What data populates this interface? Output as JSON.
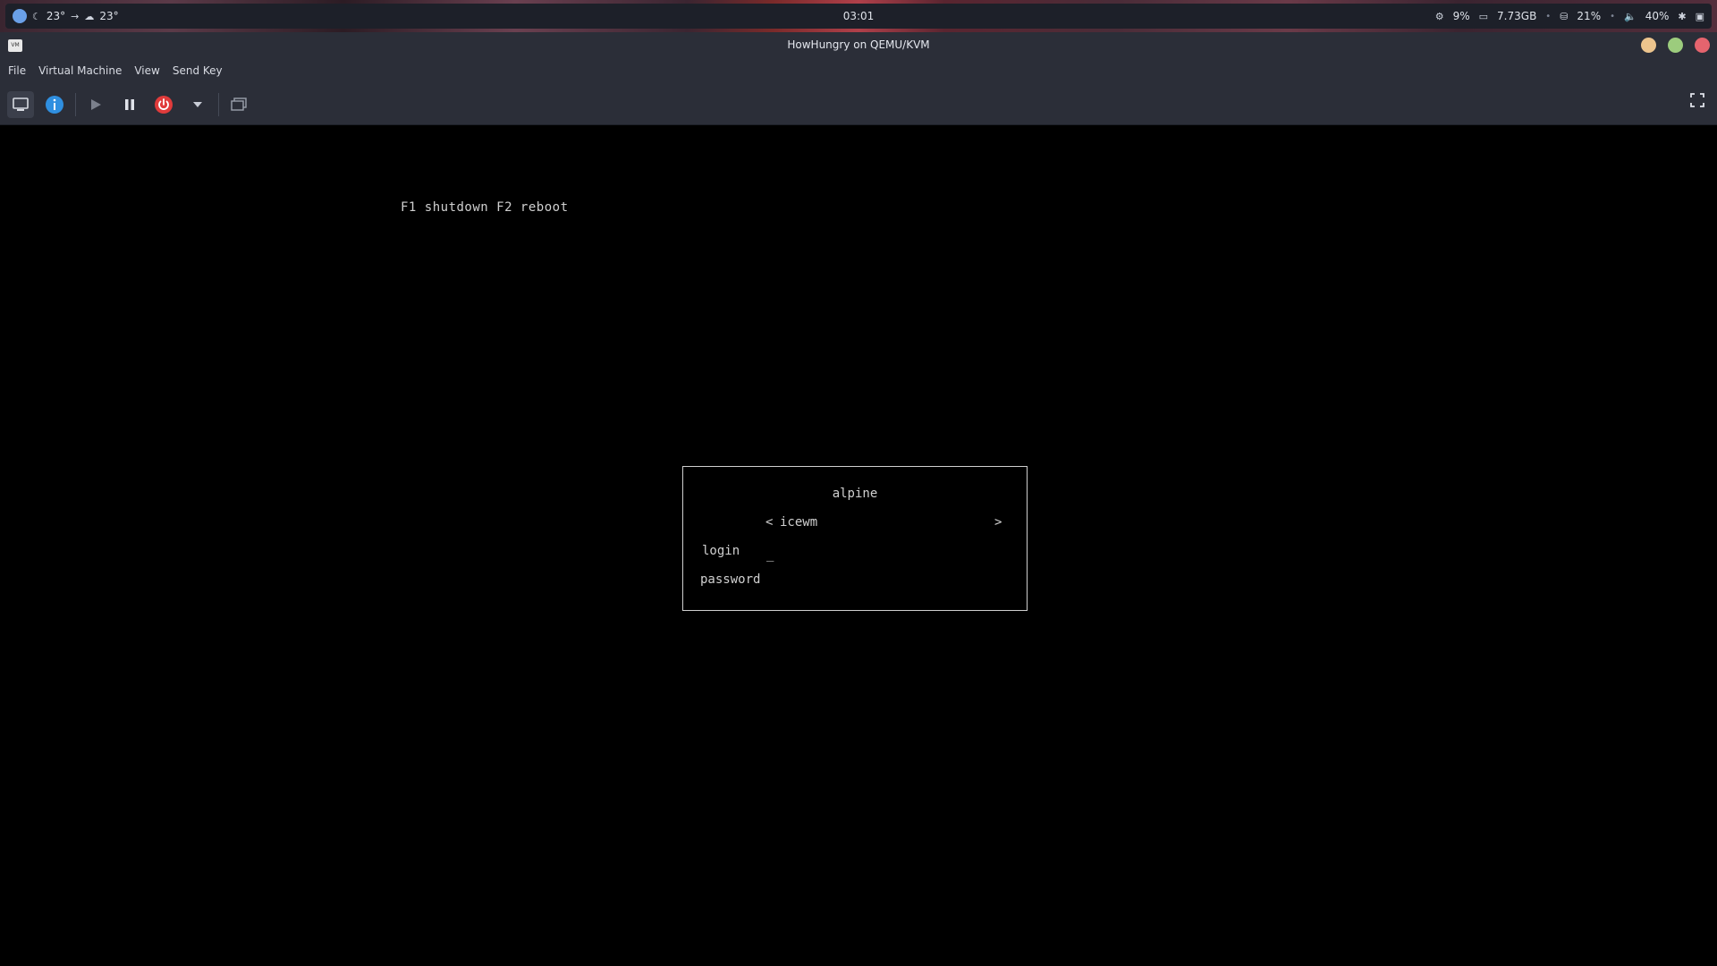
{
  "topbar": {
    "weather_now": "23°",
    "weather_next": "23°",
    "clock": "03:01",
    "cpu": "9%",
    "memory": "7.73GB",
    "disk": "21%",
    "volume": "40%"
  },
  "window": {
    "title": "HowHungry on QEMU/KVM",
    "app_icon_text": "VM"
  },
  "menu": [
    "File",
    "Virtual Machine",
    "View",
    "Send Key"
  ],
  "colors": {
    "close": "#e5646e",
    "maximize": "#9ccc7d",
    "minimize": "#ecc48d",
    "power": "#e03b3b",
    "info": "#2f8fe0"
  },
  "console": {
    "hint": "F1 shutdown F2 reboot",
    "hostname": "alpine",
    "session_prev": "<",
    "session": "icewm",
    "session_next": ">",
    "login_label": "login",
    "password_label": "password",
    "cursor": "_"
  }
}
